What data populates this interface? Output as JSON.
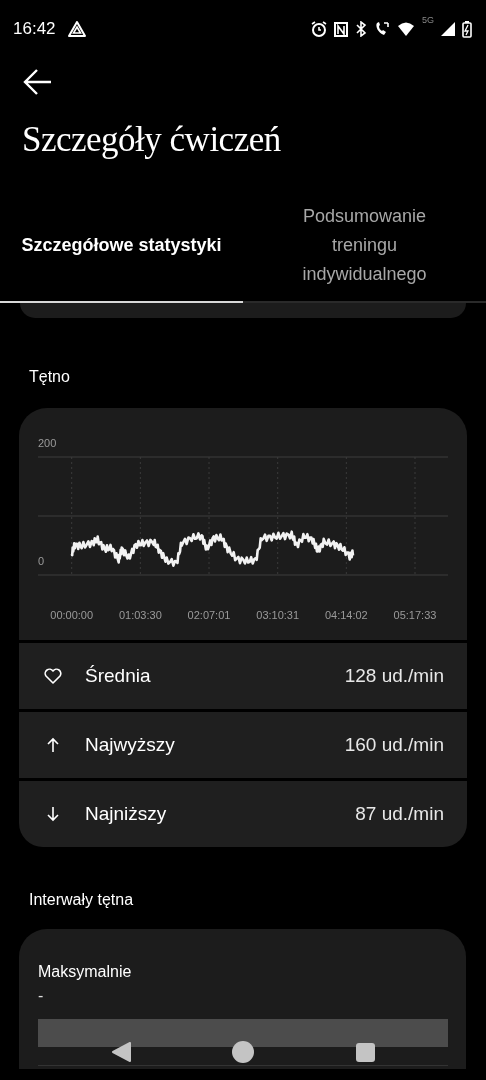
{
  "status_bar": {
    "time": "16:42",
    "network": "5G"
  },
  "header": {
    "title": "Szczegóły ćwiczeń"
  },
  "tabs": [
    {
      "label": "Szczegółowe statystyki",
      "selected": true
    },
    {
      "label": "Podsumowanie treningu indywidualnego",
      "selected": false
    }
  ],
  "heart_rate": {
    "title": "Tętno",
    "chart": {
      "y_labels": [
        "200",
        "0"
      ],
      "x_labels": [
        "00:00:00",
        "01:03:30",
        "02:07:01",
        "03:10:31",
        "04:14:02",
        "05:17:33"
      ]
    },
    "stats": [
      {
        "kind": "average",
        "label": "Średnia",
        "value": "128 ud./min"
      },
      {
        "kind": "max",
        "label": "Najwyższy",
        "value": "160 ud./min"
      },
      {
        "kind": "min",
        "label": "Najniższy",
        "value": "87 ud./min"
      }
    ]
  },
  "heart_rate_zones": {
    "title": "Interwały tętna",
    "items": [
      {
        "label": "Maksymalnie",
        "value": "-"
      }
    ]
  }
}
